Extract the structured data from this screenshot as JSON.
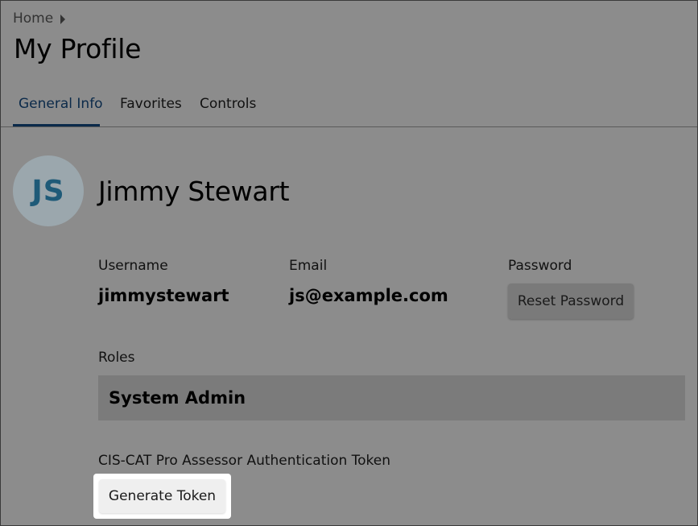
{
  "breadcrumb": {
    "home": "Home"
  },
  "page": {
    "title": "My Profile"
  },
  "tabs": [
    {
      "label": "General Info",
      "active": true
    },
    {
      "label": "Favorites",
      "active": false
    },
    {
      "label": "Controls",
      "active": false
    }
  ],
  "profile": {
    "initials": "JS",
    "name": "Jimmy Stewart",
    "username_label": "Username",
    "username": "jimmystewart",
    "email_label": "Email",
    "email": "js@example.com",
    "password_label": "Password",
    "reset_password_label": "Reset Password",
    "roles_label": "Roles",
    "roles": [
      "System Admin"
    ],
    "token_label": "CIS-CAT Pro Assessor Authentication Token",
    "generate_token_label": "Generate Token"
  },
  "colors": {
    "accent": "#0b2a4a",
    "avatar_text": "#1e5a78"
  }
}
